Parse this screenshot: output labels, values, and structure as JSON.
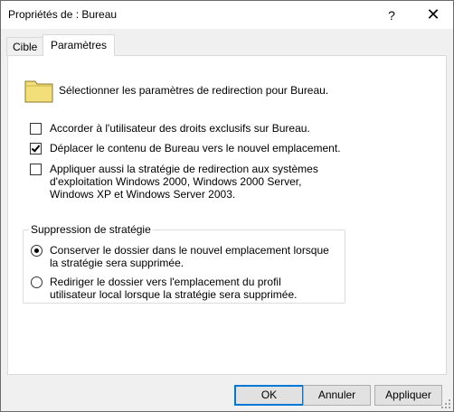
{
  "window": {
    "title": "Propriétés de : Bureau",
    "help_label": "?",
    "close_label": "✕"
  },
  "tabs": [
    {
      "label": "Cible",
      "active": false
    },
    {
      "label": "Paramètres",
      "active": true
    }
  ],
  "panel": {
    "intro": "Sélectionner les paramètres de redirection pour Bureau.",
    "folder_icon": "folder-icon",
    "options": [
      {
        "label": "Accorder à l'utilisateur des droits exclusifs sur Bureau.",
        "checked": false
      },
      {
        "label": "Déplacer le contenu de Bureau vers le nouvel emplacement.",
        "checked": true
      },
      {
        "label": "Appliquer aussi la stratégie de redirection aux systèmes d'exploitation Windows 2000, Windows 2000 Server, Windows XP et Windows Server 2003.",
        "checked": false
      }
    ],
    "group": {
      "title": "Suppression de stratégie",
      "options": [
        {
          "label": "Conserver le dossier dans le nouvel emplacement lorsque la stratégie sera supprimée.",
          "selected": true
        },
        {
          "label": "Rediriger le dossier vers l'emplacement du profil utilisateur local lorsque la stratégie sera supprimée.",
          "selected": false
        }
      ]
    }
  },
  "buttons": {
    "ok": "OK",
    "cancel": "Annuler",
    "apply": "Appliquer"
  },
  "colors": {
    "default_button_border": "#0078d7",
    "folder_fill": "#f2df7a"
  }
}
